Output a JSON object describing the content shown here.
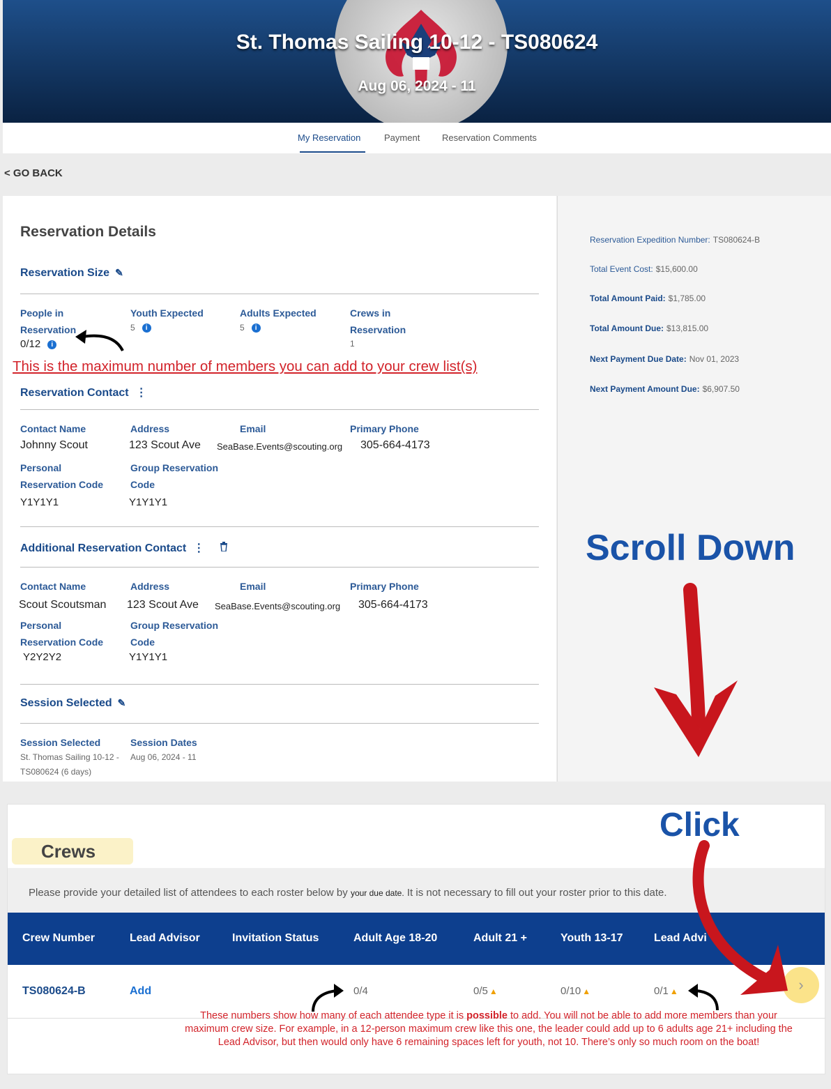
{
  "header": {
    "title": "St. Thomas Sailing 10-12 - TS080624",
    "dates": "Aug 06, 2024 - 11"
  },
  "tabs": [
    {
      "label": "My Reservation",
      "active": true
    },
    {
      "label": "Payment",
      "active": false
    },
    {
      "label": "Reservation Comments",
      "active": false
    }
  ],
  "go_back": "< GO BACK",
  "details": {
    "title": "Reservation Details",
    "size": {
      "heading": "Reservation Size",
      "people_label": "People in Reservation",
      "people_value": "0/12",
      "youth_label": "Youth Expected",
      "youth_value": "5",
      "adults_label": "Adults Expected",
      "adults_value": "5",
      "crews_label": "Crews in Reservation",
      "crews_value": "1"
    },
    "contact": {
      "heading": "Reservation Contact",
      "name_label": "Contact Name",
      "name": "Johnny Scout",
      "address_label": "Address",
      "address": "123 Scout Ave",
      "email_label": "Email",
      "email": "SeaBase.Events@scouting.org",
      "phone_label": "Primary Phone",
      "phone": "305-664-4173",
      "personal_code_label": "Personal Reservation Code",
      "personal_code": "Y1Y1Y1",
      "group_code_label": "Group Reservation Code",
      "group_code": "Y1Y1Y1"
    },
    "additional_contact": {
      "heading": "Additional Reservation Contact",
      "name_label": "Contact Name",
      "name": "Scout Scoutsman",
      "address_label": "Address",
      "address": "123 Scout Ave",
      "email_label": "Email",
      "email": "SeaBase.Events@scouting.org",
      "phone_label": "Primary Phone",
      "phone": "305-664-4173",
      "personal_code_label": "Personal Reservation Code",
      "personal_code": "Y2Y2Y2",
      "group_code_label": "Group Reservation Code",
      "group_code": "Y1Y1Y1"
    },
    "session": {
      "heading": "Session Selected",
      "selected_label": "Session Selected",
      "selected": "St. Thomas Sailing 10-12 - TS080624 (6 days)",
      "dates_label": "Session Dates",
      "dates": "Aug 06, 2024 - 11"
    }
  },
  "summary": {
    "expedition_label": "Reservation Expedition Number:",
    "expedition_value": "TS080624-B",
    "cost_label": "Total Event Cost:",
    "cost_value": "$15,600.00",
    "paid_label": "Total Amount Paid:",
    "paid_value": "$1,785.00",
    "due_label": "Total Amount Due:",
    "due_value": "$13,815.00",
    "next_date_label": "Next Payment Due Date:",
    "next_date_value": "Nov 01, 2023",
    "next_amount_label": "Next Payment Amount Due:",
    "next_amount_value": "$6,907.50"
  },
  "annotations": {
    "max_members": "This is the maximum number of members you can add to your crew list(s)",
    "scroll_down": "Scroll Down",
    "click": "Click",
    "crew_note_1": "These numbers show how many of each attendee type it is",
    "crew_note_bold": "possible",
    "crew_note_2": "to add.  You will not be able to add more members than your maximum crew size. For example, in a 12-person maximum crew like this one, the leader could add up to 6 adults age 21+ including the Lead Advisor, but then would only have 6 remaining spaces left for youth, not 10. There’s only so much room on the boat!"
  },
  "crews": {
    "title": "Crews",
    "note_1": "Please provide your detailed list of attendees to each roster below by",
    "note_due": "your due date.",
    "note_2": "It is not necessary to fill out your roster prior to this date.",
    "columns": [
      "Crew Number",
      "Lead Advisor",
      "Invitation Status",
      "Adult Age 18-20",
      "Adult 21 +",
      "Youth 13-17",
      "Lead Advi"
    ],
    "row": {
      "crew_number": "TS080624-B",
      "lead_advisor": "Add",
      "invitation_status": "",
      "adult_18_20": "0/4",
      "adult_21": "0/5",
      "youth": "0/10",
      "lead_advisor_count": "0/1"
    }
  },
  "colors": {
    "brand_blue": "#1a4a8a",
    "table_header": "#0d3f8e",
    "annotation_red": "#d2232a",
    "annotation_blue": "#1a53a8",
    "warning": "#f0a000"
  }
}
